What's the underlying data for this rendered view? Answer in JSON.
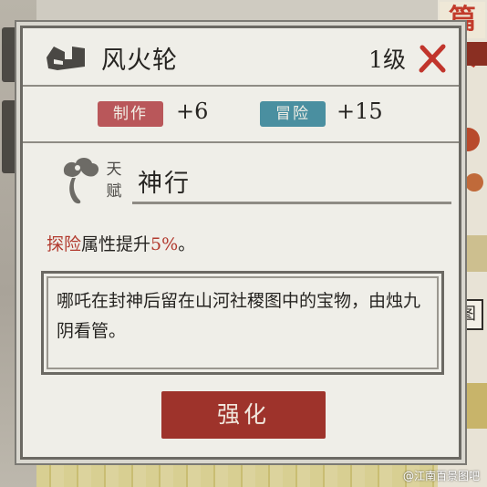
{
  "item": {
    "name": "风火轮",
    "level": "1级",
    "icon": "wind-fire-wheel-icon"
  },
  "stats": [
    {
      "label": "制作",
      "value": "+6",
      "color": "#b9575a"
    },
    {
      "label": "冒险",
      "value": "+15",
      "color": "#4a8fa0"
    }
  ],
  "talent": {
    "label": "天赋",
    "name": "神行",
    "icon": "cloud-icon",
    "effect": {
      "keyword": "探险",
      "text": "属性提升",
      "value": "5%",
      "suffix": "。"
    }
  },
  "description": "哪吒在封神后留在山河社稷图中的宝物，由烛九阴看管。",
  "upgrade_label": "强化",
  "background": {
    "right_label": "篇级",
    "tag_text": "图"
  },
  "watermark": "@江南百景图吧",
  "colors": {
    "accent_red": "#9e332b",
    "highlight_red": "#b23a2e",
    "card_bg": "#efeee8"
  }
}
